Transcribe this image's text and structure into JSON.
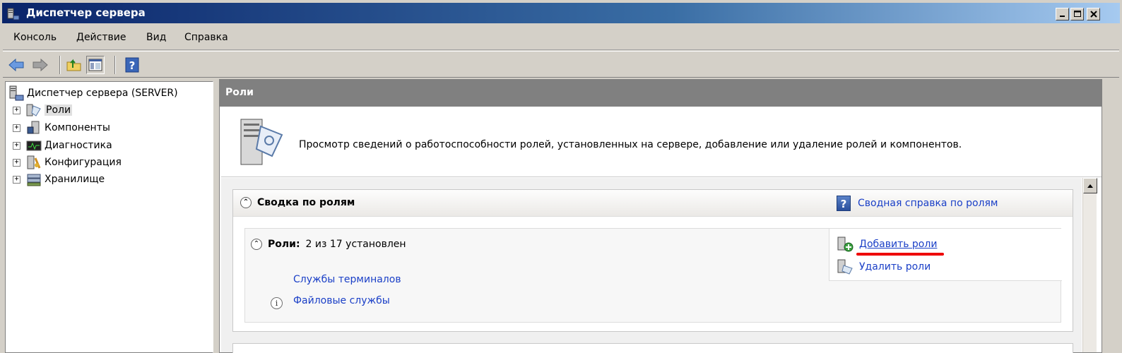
{
  "window": {
    "title": "Диспетчер сервера",
    "controls": [
      "minimize-icon",
      "maximize-icon",
      "close-icon"
    ]
  },
  "menu": [
    "Консоль",
    "Действие",
    "Вид",
    "Справка"
  ],
  "toolbar": {
    "buttons": [
      "back-arrow-icon",
      "forward-arrow-icon",
      "up-folder-icon",
      "show-hide-tree-icon",
      "help-icon"
    ]
  },
  "tree": {
    "root": "Диспетчер сервера (SERVER)",
    "nodes": [
      {
        "label": "Роли",
        "icon": "roles-icon",
        "selected": true
      },
      {
        "label": "Компоненты",
        "icon": "features-icon"
      },
      {
        "label": "Диагностика",
        "icon": "diagnostics-icon"
      },
      {
        "label": "Конфигурация",
        "icon": "configuration-icon"
      },
      {
        "label": "Хранилище",
        "icon": "storage-icon"
      }
    ]
  },
  "main": {
    "header": "Роли",
    "intro": "Просмотр сведений о работоспособности ролей, установленных на сервере, добавление или удаление ролей и компонентов.",
    "summary": {
      "title": "Сводка по ролям",
      "help_link": "Сводная справка по ролям",
      "roles_label": "Роли:",
      "roles_count": "2 из 17 установлен",
      "installed": [
        "Службы терминалов",
        "Файловые службы"
      ],
      "actions": [
        "Добавить роли",
        "Удалить роли"
      ]
    }
  },
  "colors": {
    "title_gradient_start": "#0a246a",
    "link": "#1a3fc7",
    "highlight_underline": "#e00000",
    "header_gray": "#808080"
  }
}
